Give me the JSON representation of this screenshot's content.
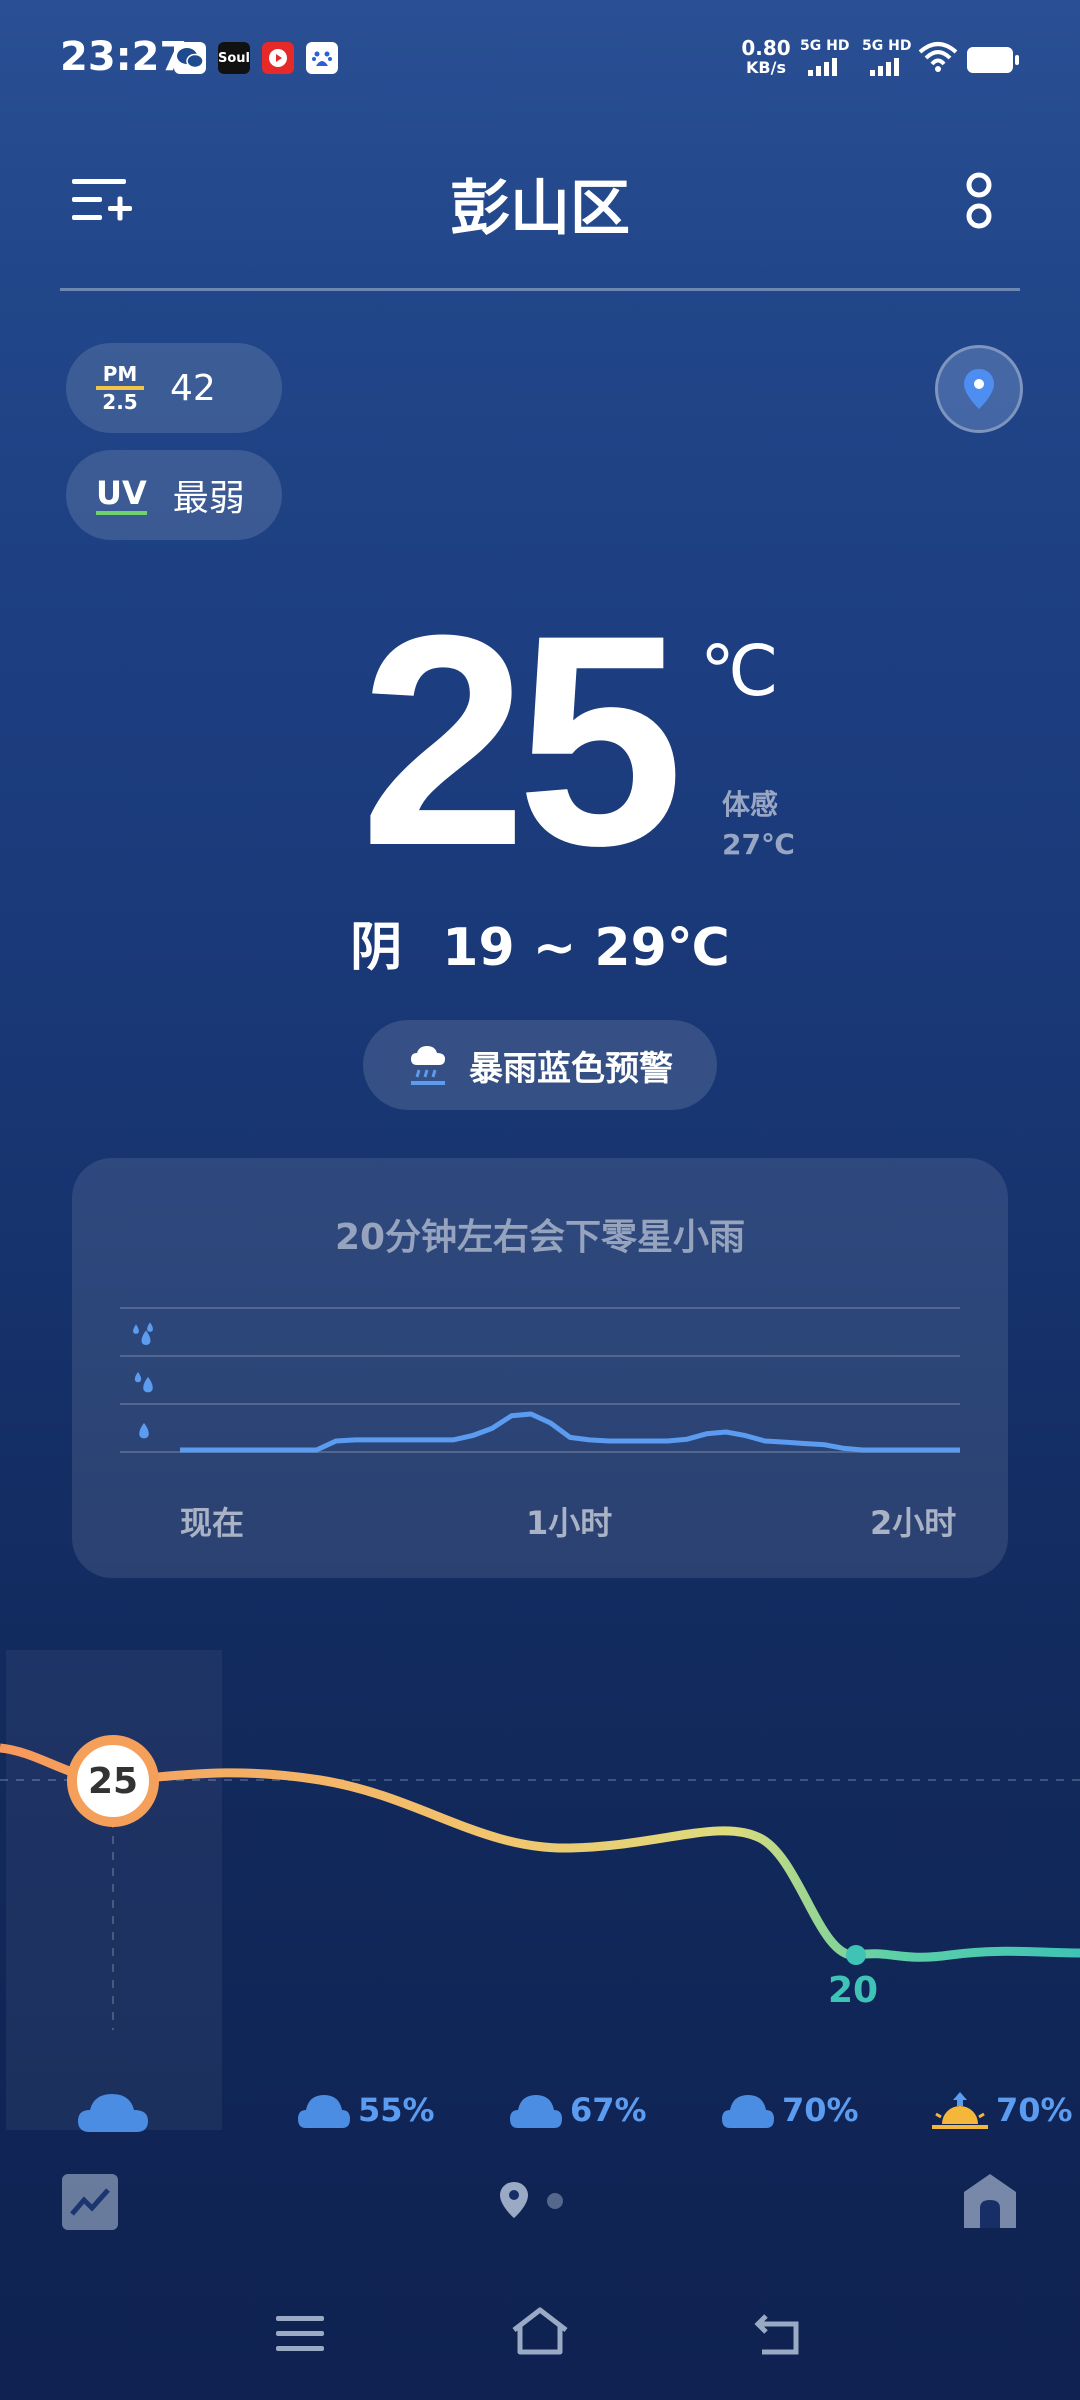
{
  "status_bar": {
    "time": "23:27",
    "net_speed_value": "0.80",
    "net_speed_unit": "KB/s",
    "sim1_label": "5G HD",
    "sim2_label": "5G HD",
    "app_icons": [
      "wechat-icon",
      "soul-app-icon",
      "video-app-icon",
      "baidu-icon"
    ],
    "soul_label": "Soul"
  },
  "header": {
    "city": "彭山区",
    "add_city_icon": "add-city-icon",
    "more_icon": "more-icon"
  },
  "air": {
    "pm_label_top": "PM",
    "pm_label_bottom": "2.5",
    "pm_value": "42",
    "uv_label": "UV",
    "uv_value": "最弱"
  },
  "current": {
    "temperature": "25",
    "unit": "℃",
    "feels_label": "体感",
    "feels_value": "27℃",
    "condition": "阴",
    "range": "19 ~ 29℃"
  },
  "alert": {
    "text": "暴雨蓝色预警",
    "icon": "storm-rain-icon"
  },
  "rain_forecast": {
    "title": "20分钟左右会下零星小雨",
    "x_labels": [
      "现在",
      "1小时",
      "2小时"
    ]
  },
  "chart_data": {
    "type": "line",
    "title": "20分钟左右会下零星小雨",
    "xlabel": "",
    "ylabel": "",
    "x_labels": [
      "现在",
      "1小时",
      "2小时"
    ],
    "y_levels": [
      "light",
      "moderate",
      "heavy"
    ],
    "series": [
      {
        "x": [
          0,
          0.1,
          0.15,
          0.2,
          0.3,
          0.35,
          0.4,
          0.45,
          0.5,
          0.55,
          0.6,
          0.65,
          0.7,
          0.75,
          0.8,
          0.85,
          0.9,
          0.95,
          1.0,
          1.05,
          1.1,
          1.15,
          1.2,
          1.25,
          1.3,
          1.35,
          1.4,
          1.45,
          1.5,
          1.55,
          1.6,
          1.65,
          1.7,
          1.75,
          1.8,
          1.85,
          1.9,
          1.95,
          2.0
        ],
        "values": [
          0,
          0,
          0,
          0,
          0,
          0,
          0.25,
          0.28,
          0.28,
          0.28,
          0.28,
          0.28,
          0.28,
          0.4,
          0.6,
          0.95,
          1.0,
          0.75,
          0.35,
          0.28,
          0.25,
          0.25,
          0.25,
          0.25,
          0.3,
          0.45,
          0.5,
          0.4,
          0.25,
          0.22,
          0.18,
          0.15,
          0.05,
          0.0,
          0,
          0,
          0,
          0,
          0
        ]
      }
    ],
    "xlim": [
      0,
      2
    ],
    "grid": true
  },
  "hourly": {
    "temps": [
      {
        "value": 25,
        "label": "25"
      },
      {
        "value": 20,
        "label": "20"
      }
    ],
    "items": [
      {
        "icon": "cloud-icon",
        "pct": ""
      },
      {
        "icon": "cloud-icon",
        "pct": "55%"
      },
      {
        "icon": "cloud-icon",
        "pct": "67%"
      },
      {
        "icon": "cloud-icon",
        "pct": "70%"
      },
      {
        "icon": "sunrise-icon",
        "pct": "70%"
      }
    ]
  },
  "bottom_bar": {
    "trend_icon": "trend-chart-icon",
    "location_icon": "location-pin-icon",
    "home_icon": "home-card-icon"
  },
  "nav": {
    "menu_icon": "menu-icon",
    "home_icon": "home-icon",
    "back_icon": "back-icon"
  },
  "colors": {
    "accent_orange": "#f5a05a",
    "accent_teal": "#3fc3b6",
    "rain_line": "#5b9cf0"
  }
}
